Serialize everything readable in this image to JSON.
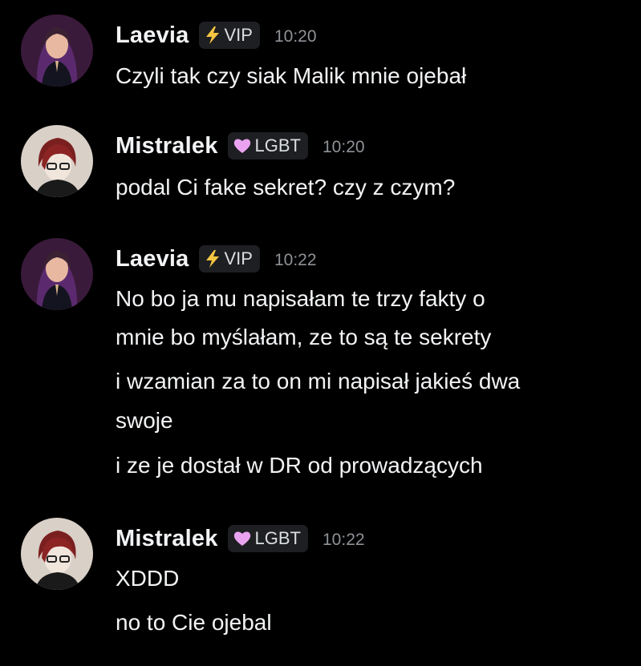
{
  "messages": [
    {
      "author": "Laevia",
      "badge": {
        "label": "VIP",
        "icon": "lightning-icon",
        "color": "#f5c542"
      },
      "time": "10:20",
      "lines": [
        "Czyli tak czy siak Malik mnie ojebał"
      ]
    },
    {
      "author": "Mistralek",
      "badge": {
        "label": "LGBT",
        "icon": "pink-heart-icon",
        "color": "#e9a3f0"
      },
      "time": "10:20",
      "lines": [
        "podal Ci fake sekret? czy z czym?"
      ]
    },
    {
      "author": "Laevia",
      "badge": {
        "label": "VIP",
        "icon": "lightning-icon",
        "color": "#f5c542"
      },
      "time": "10:22",
      "lines": [
        "No bo ja mu napisałam te trzy fakty o",
        "mnie bo myślałam, ze to są te sekrety",
        "i wzamian za to on mi napisał jakieś dwa",
        "swoje",
        "i ze je dostał w DR od prowadzących"
      ]
    },
    {
      "author": "Mistralek",
      "badge": {
        "label": "LGBT",
        "icon": "pink-heart-icon",
        "color": "#e9a3f0"
      },
      "time": "10:22",
      "lines": [
        "XDDD",
        "no to Cie ojebal"
      ]
    }
  ],
  "colors": {
    "background": "#000000",
    "text": "#f2f3f5",
    "timestamp": "#8e9297",
    "badge_bg": "#1e1f22"
  }
}
